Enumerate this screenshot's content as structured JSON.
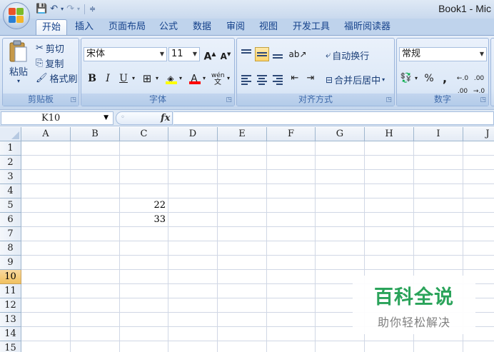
{
  "window": {
    "title": "Book1 - Mic"
  },
  "quick_access": {
    "undo_icon": "undo-icon",
    "redo_icon": "redo-icon",
    "customize_icon": "customize-qat-icon"
  },
  "tabs": [
    {
      "label": "开始",
      "active": true
    },
    {
      "label": "插入"
    },
    {
      "label": "页面布局"
    },
    {
      "label": "公式"
    },
    {
      "label": "数据"
    },
    {
      "label": "审阅"
    },
    {
      "label": "视图"
    },
    {
      "label": "开发工具"
    },
    {
      "label": "福昕阅读器"
    }
  ],
  "ribbon": {
    "clipboard": {
      "label": "剪贴板",
      "paste": "粘贴",
      "cut": "剪切",
      "copy": "复制",
      "format_painter": "格式刷"
    },
    "font": {
      "label": "字体",
      "font_name": "宋体",
      "font_size": "11",
      "bold": "B",
      "italic": "I",
      "underline": "U",
      "phonetic": "wén"
    },
    "alignment": {
      "label": "对齐方式",
      "wrap_text": "自动换行",
      "merge_center": "合并后居中"
    },
    "number": {
      "label": "数字",
      "format": "常规",
      "percent": "%",
      "comma": ","
    },
    "colors": {
      "highlight": "#ffff00",
      "font_color": "#ff0000"
    }
  },
  "formula_bar": {
    "name_box": "K10",
    "fx_label": "fx",
    "content": ""
  },
  "sheet": {
    "columns": [
      "A",
      "B",
      "C",
      "D",
      "E",
      "F",
      "G",
      "H",
      "I",
      "J"
    ],
    "rows": [
      "1",
      "2",
      "3",
      "4",
      "5",
      "6",
      "7",
      "8",
      "9",
      "10",
      "11",
      "12",
      "13",
      "14",
      "15"
    ],
    "selected_row": "10",
    "cells": [
      {
        "ref": "C5",
        "value": "22"
      },
      {
        "ref": "C6",
        "value": "33"
      }
    ]
  },
  "watermark": {
    "title": "百科全说",
    "subtitle": "助你轻松解决"
  }
}
